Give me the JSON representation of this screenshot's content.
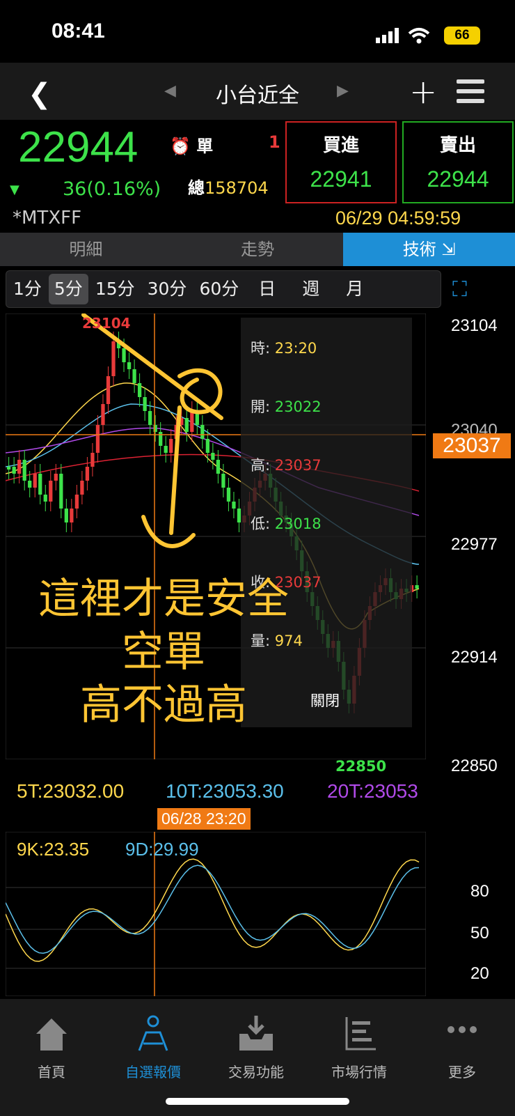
{
  "status": {
    "time": "08:41",
    "battery": "66"
  },
  "nav": {
    "title": "小台近全"
  },
  "quote": {
    "price": "22944",
    "change": "36(0.16%)",
    "single_label": "單",
    "single_value": "1",
    "total_label": "總",
    "total_value": "158704",
    "bid_label": "買進",
    "bid_value": "22941",
    "ask_label": "賣出",
    "ask_value": "22944",
    "symbol": "*MTXFF",
    "datetime": "06/29 04:59:59"
  },
  "tabs": [
    "明細",
    "走勢",
    "技術 ⇲"
  ],
  "timeframes": [
    "1分",
    "5分",
    "15分",
    "30分",
    "60分",
    "日",
    "週",
    "月"
  ],
  "selected_timeframe": "5分",
  "tooltip": {
    "time_label": "時:",
    "time": "23:20",
    "open_label": "開:",
    "open": "23022",
    "high_label": "高:",
    "high": "23037",
    "low_label": "低:",
    "low": "23018",
    "close_label": "收:",
    "close": "23037",
    "volume_label": "量:",
    "volume": "974",
    "close_button": "關閉"
  },
  "price_axis": {
    "labels": [
      "23104",
      "23040",
      "22977",
      "22914",
      "22850"
    ],
    "current": "23037"
  },
  "chart_labels": {
    "high": "23104",
    "low": "22850"
  },
  "moving_averages": {
    "ma5": "5T:23032.00",
    "ma10": "10T:23053.30",
    "ma20": "20T:23053"
  },
  "cursor_date": "06/28 23:20",
  "kd": {
    "k": "9K:23.35",
    "d": "9D:29.99",
    "levels": [
      "80",
      "50",
      "20"
    ]
  },
  "annotation": {
    "line1": "這裡才是安全",
    "line2": "空單",
    "line3": "高不過高"
  },
  "bottom_nav": [
    "首頁",
    "自選報價",
    "交易功能",
    "市場行情",
    "更多"
  ],
  "colors": {
    "up": "#e83a3a",
    "down": "#3de24a",
    "accent": "#1e8fd6",
    "highlight": "#f07a14",
    "annotation": "#ffc533"
  }
}
